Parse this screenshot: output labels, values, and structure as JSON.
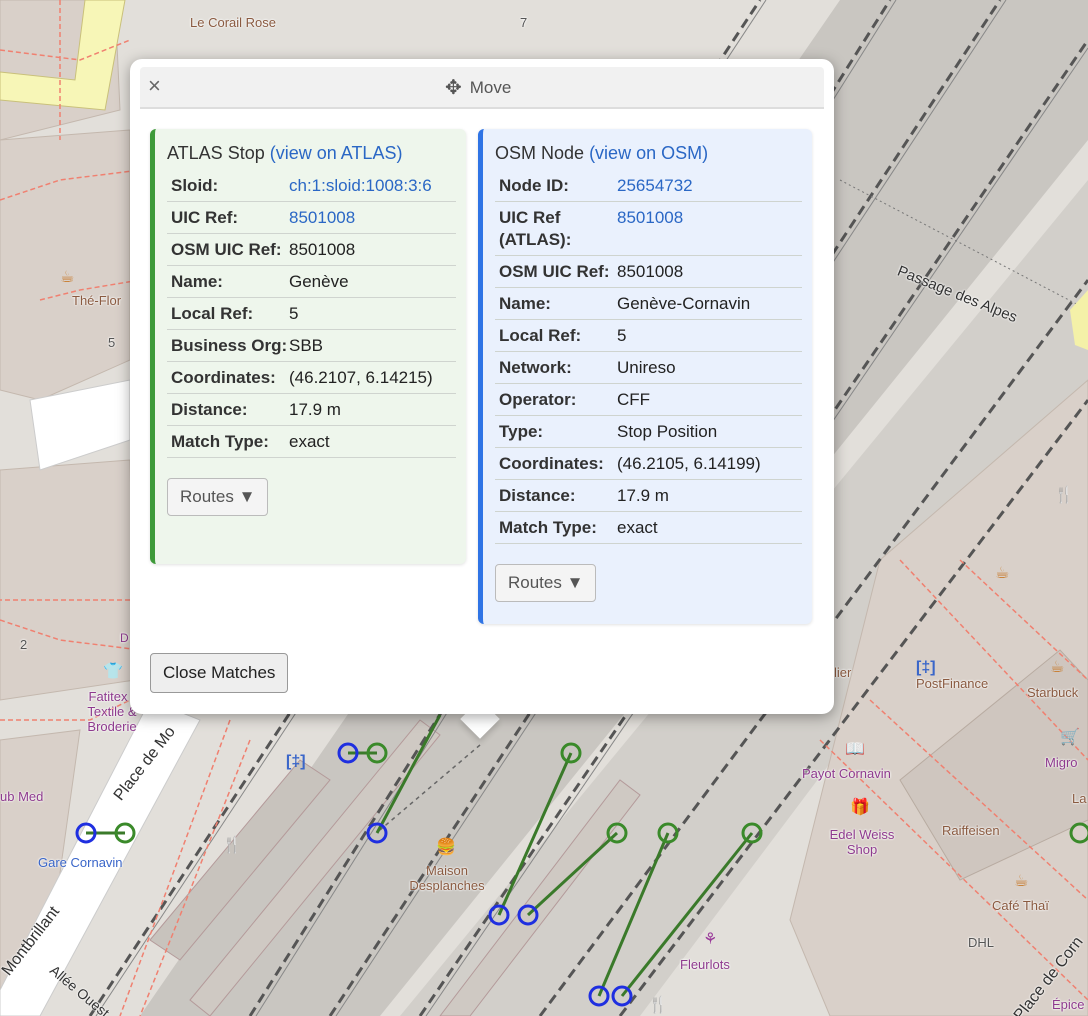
{
  "popup": {
    "close_label": "×",
    "move_label": "Move",
    "close_matches_label": "Close Matches"
  },
  "atlas": {
    "title": "ATLAS Stop",
    "link_text": "(view on ATLAS)",
    "routes_label": "Routes ▼",
    "rows": [
      {
        "key": "Sloid:",
        "value": "ch:1:sloid:1008:3:6"
      },
      {
        "key": "UIC Ref:",
        "value": "8501008"
      },
      {
        "key": "OSM UIC Ref:",
        "value": "8501008"
      },
      {
        "key": "Name:",
        "value": "Genève"
      },
      {
        "key": "Local Ref:",
        "value": "5"
      },
      {
        "key": "Business Org:",
        "value": "SBB"
      },
      {
        "key": "Coordinates:",
        "value": "(46.2107, 6.14215)"
      },
      {
        "key": "Distance:",
        "value": "17.9 m"
      },
      {
        "key": "Match Type:",
        "value": "exact"
      }
    ]
  },
  "osm": {
    "title": "OSM Node",
    "link_text": "(view on OSM)",
    "routes_label": "Routes ▼",
    "rows": [
      {
        "key": "Node ID:",
        "value": "25654732"
      },
      {
        "key": "UIC Ref (ATLAS):",
        "value": "8501008"
      },
      {
        "key": "OSM UIC Ref:",
        "value": "8501008"
      },
      {
        "key": "Name:",
        "value": "Genève-Cornavin"
      },
      {
        "key": "Local Ref:",
        "value": "5"
      },
      {
        "key": "Network:",
        "value": "Unireso"
      },
      {
        "key": "Operator:",
        "value": "CFF"
      },
      {
        "key": "Type:",
        "value": "Stop Position"
      },
      {
        "key": "Coordinates:",
        "value": "(46.2105, 6.14199)"
      },
      {
        "key": "Distance:",
        "value": "17.9 m"
      },
      {
        "key": "Match Type:",
        "value": "exact"
      }
    ]
  },
  "map_labels": {
    "le_corail_rose": "Le Corail Rose",
    "the_flor": "Thé-Flor",
    "passage_des_alpes": "Passage des Alpes",
    "fatitex": "Fatitex - Textile & Broderie",
    "club_med": "ub Med",
    "place_de_mo": "Place de Mo",
    "gare_cornavin": "Gare Cornavin",
    "montbrillant": "Montbrillant",
    "allee_ouest": "Allée Ouest",
    "maison_desplanches": "Maison Desplanches",
    "payot_cornavin": "Payot Cornavin",
    "edelweiss_shop": "Edel Weiss Shop",
    "raiffeisen": "Raiffeisen",
    "fleurlots": "Fleurlots",
    "postfinance": "PostFinance",
    "starbuck": "Starbuck",
    "migro": "Migro",
    "cafe_thai": "Café Thaï",
    "dhl": "DHL",
    "place_de_corn": "Place de Corn",
    "epice": "Épice",
    "num_7": "7",
    "num_5": "5",
    "num_2": "2",
    "lier": "lier",
    "la": "La",
    "d_th": "D - Th"
  }
}
